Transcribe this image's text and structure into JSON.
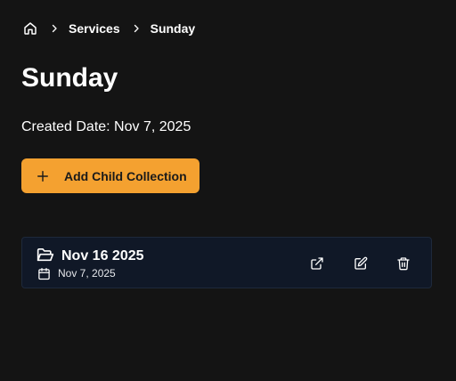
{
  "breadcrumb": {
    "home_icon": "home-icon",
    "separator_icon": "chevron-right-icon",
    "items": [
      "Services",
      "Sunday"
    ]
  },
  "page": {
    "title": "Sunday",
    "created_date": "Created Date: Nov 7, 2025"
  },
  "actions": {
    "add_child_label": "Add Child Collection",
    "add_icon": "plus-icon"
  },
  "collections": [
    {
      "name": "Nov 16 2025",
      "date": "Nov 7, 2025",
      "icon": "folder-open-icon",
      "date_icon": "calendar-icon",
      "action_icons": [
        "external-link-icon",
        "edit-icon",
        "trash-icon"
      ]
    }
  ],
  "colors": {
    "background": "#141414",
    "accent": "#f4a130",
    "card_background": "#101827",
    "card_border": "#1e293b"
  }
}
